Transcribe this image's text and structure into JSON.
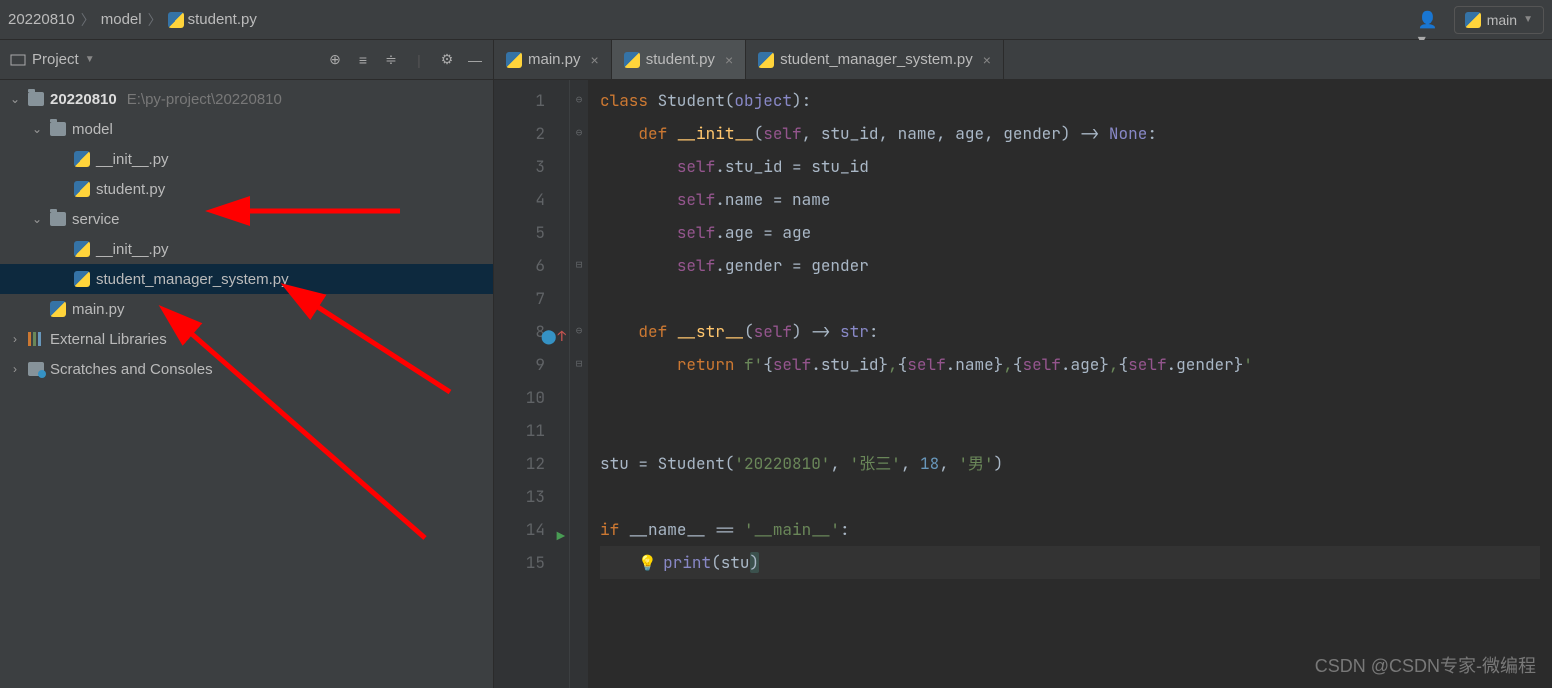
{
  "breadcrumbs": [
    "20220810",
    "model",
    "student.py"
  ],
  "run_config": {
    "label": "main"
  },
  "sidebar": {
    "title": "Project",
    "tree": [
      {
        "name": "20220810",
        "path": "E:\\py-project\\20220810",
        "type": "folder",
        "expanded": true,
        "indent": 0,
        "bold": true
      },
      {
        "name": "model",
        "type": "folder",
        "expanded": true,
        "indent": 1
      },
      {
        "name": "__init__.py",
        "type": "py",
        "indent": 2
      },
      {
        "name": "student.py",
        "type": "py",
        "indent": 2
      },
      {
        "name": "service",
        "type": "folder",
        "expanded": true,
        "indent": 1
      },
      {
        "name": "__init__.py",
        "type": "py",
        "indent": 2
      },
      {
        "name": "student_manager_system.py",
        "type": "py",
        "indent": 2,
        "selected": true
      },
      {
        "name": "main.py",
        "type": "py",
        "indent": 1
      },
      {
        "name": "External Libraries",
        "type": "lib",
        "expanded": false,
        "indent": 0
      },
      {
        "name": "Scratches and Consoles",
        "type": "scratch",
        "expanded": false,
        "indent": 0
      }
    ]
  },
  "tabs": [
    {
      "label": "main.py",
      "active": false
    },
    {
      "label": "student.py",
      "active": true
    },
    {
      "label": "student_manager_system.py",
      "active": false
    }
  ],
  "code_lines": [
    {
      "n": 1,
      "fold": "⊖",
      "html": "<span class='kw'>class </span><span class='txt'>Student(</span><span class='bi'>object</span><span class='txt'>):</span>"
    },
    {
      "n": 2,
      "fold": "⊖",
      "html": "    <span class='kw'>def </span><span class='fn'>__init__</span><span class='txt'>(</span><span class='self'>self</span><span class='op'>, </span><span class='par'>stu_id</span><span class='op'>, </span><span class='par'>name</span><span class='op'>, </span><span class='par'>age</span><span class='op'>, </span><span class='par'>gender</span><span class='txt'>) -&gt; </span><span class='bi'>None</span><span class='txt'>:</span>"
    },
    {
      "n": 3,
      "html": "        <span class='self'>self</span><span class='txt'>.stu_id = stu_id</span>"
    },
    {
      "n": 4,
      "html": "        <span class='self'>self</span><span class='txt'>.name = name</span>"
    },
    {
      "n": 5,
      "html": "        <span class='self'>self</span><span class='txt'>.age = age</span>"
    },
    {
      "n": 6,
      "fold": "⊟",
      "html": "        <span class='self'>self</span><span class='txt'>.gender = gender</span>"
    },
    {
      "n": 7,
      "html": ""
    },
    {
      "n": 8,
      "fold": "⊖",
      "gut": "ov",
      "html": "    <span class='kw'>def </span><span class='fn'>__str__</span><span class='txt'>(</span><span class='self'>self</span><span class='txt'>) -&gt; </span><span class='bi'>str</span><span class='txt'>:</span>"
    },
    {
      "n": 9,
      "fold": "⊟",
      "html": "        <span class='ret'>return </span><span class='str'>f'</span><span class='txt'>{</span><span class='self'>self</span><span class='txt'>.stu_id}</span><span class='str'>,</span><span class='txt'>{</span><span class='self'>self</span><span class='txt'>.name}</span><span class='str'>,</span><span class='txt'>{</span><span class='self'>self</span><span class='txt'>.age}</span><span class='str'>,</span><span class='txt'>{</span><span class='self'>self</span><span class='txt'>.gender}</span><span class='str'>'</span>"
    },
    {
      "n": 10,
      "html": ""
    },
    {
      "n": 11,
      "html": ""
    },
    {
      "n": 12,
      "html": "<span class='txt'>stu = Student(</span><span class='str'>'20220810'</span><span class='op'>, </span><span class='str'>'张三'</span><span class='op'>, </span><span class='num'>18</span><span class='op'>, </span><span class='str'>'男'</span><span class='txt'>)</span>"
    },
    {
      "n": 13,
      "html": ""
    },
    {
      "n": 14,
      "gut": "run",
      "html": "<span class='kw'>if </span><span class='txt'>__name__ == </span><span class='str'>'__main__'</span><span class='txt'>:</span>"
    },
    {
      "n": 15,
      "caret": true,
      "html": "    <span class='bulb'>💡</span><span class='bi'>print</span><span class='txt'>(stu</span><span class='hl-paren txt'>)</span>"
    }
  ],
  "watermark": "CSDN @CSDN专家-微编程"
}
